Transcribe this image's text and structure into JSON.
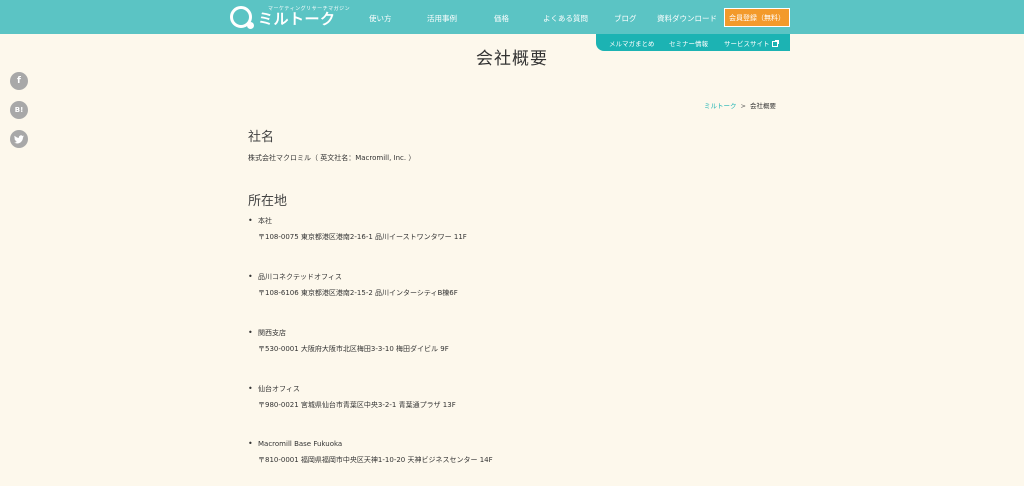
{
  "header": {
    "logo_tagline": "マーケティングリサーチマガジン",
    "logo_text": "ミルトーク",
    "nav": [
      "使い方",
      "活用事例",
      "価格",
      "よくある質問",
      "ブログ",
      "資料ダウンロード"
    ],
    "cta_label": "会員登録（無料）"
  },
  "subnav": {
    "items": [
      "メルマガまとめ",
      "セミナー情報",
      "サービスサイト"
    ]
  },
  "page": {
    "title": "会社概要"
  },
  "social": {
    "facebook": "f",
    "hatena": "B!",
    "twitter": "t"
  },
  "breadcrumb": {
    "home": "ミルトーク",
    "separator": ">",
    "current": "会社概要"
  },
  "company": {
    "heading": "社名",
    "name": "株式会社マクロミル（ 英文社名：Macromill, Inc. ）"
  },
  "locations": {
    "heading": "所在地",
    "offices": [
      {
        "name": "本社",
        "address": "〒108-0075 東京都港区港南2-16-1 品川イーストワンタワー 11F"
      },
      {
        "name": "品川コネクテッドオフィス",
        "address": "〒108-6106 東京都港区港南2-15-2 品川インターシティB棟6F"
      },
      {
        "name": "関西支店",
        "address": "〒530-0001 大阪府大阪市北区梅田3-3-10 梅田ダイビル 9F"
      },
      {
        "name": "仙台オフィス",
        "address": "〒980-0021 宮城県仙台市青葉区中央3-2-1 青葉通プラザ 13F"
      },
      {
        "name": "Macromill Base Fukuoka",
        "address": "〒810-0001 福岡県福岡市中央区天神1-10-20 天神ビジネスセンター 14F"
      }
    ]
  }
}
